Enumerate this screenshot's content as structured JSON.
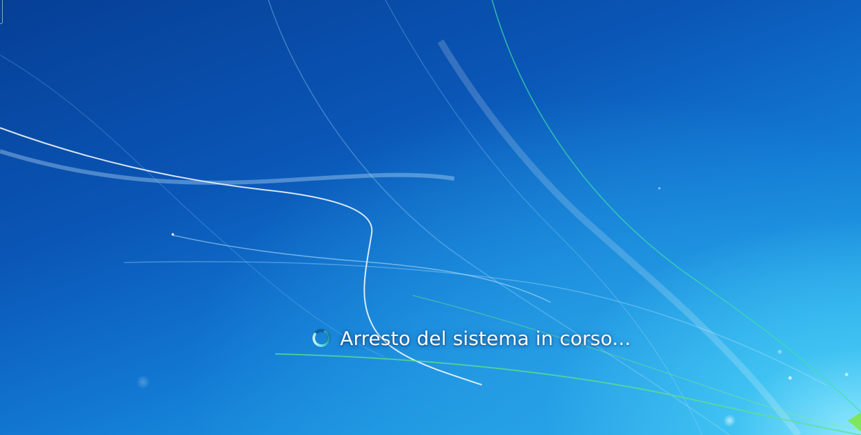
{
  "screen": {
    "status_message": "Arresto del sistema in corso...",
    "spinner_icon": "loading-spinner-icon"
  },
  "colors": {
    "background_dark": "#063f96",
    "background_mid": "#1279d3",
    "background_light": "#49c8f0",
    "text": "#ffffff"
  }
}
